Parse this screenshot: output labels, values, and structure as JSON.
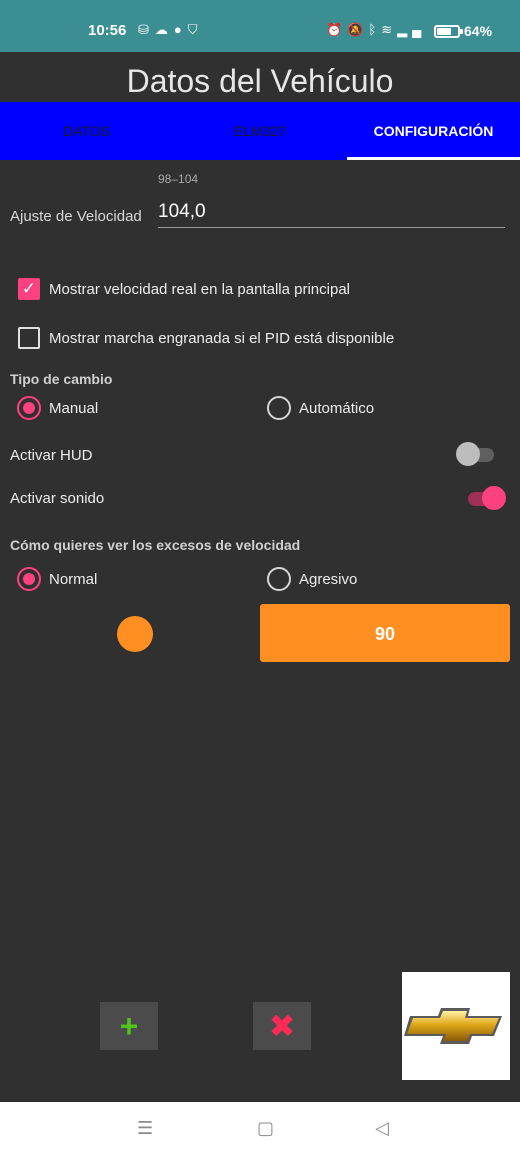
{
  "status_bar": {
    "time": "10:56",
    "left_icons": [
      "sim-icon",
      "cloud-icon",
      "app-icon",
      "shield-icon"
    ],
    "right_icons": [
      "alarm-icon",
      "mute-icon",
      "bluetooth-icon",
      "wifi-icon",
      "signal-icon"
    ],
    "battery_percent": "64%",
    "battery_level": 0.64,
    "background": "#3b8f92"
  },
  "app": {
    "title": "Datos del Vehículo"
  },
  "tabs": [
    {
      "label": "DATOS",
      "active": false
    },
    {
      "label": "ELM327",
      "active": false
    },
    {
      "label": "CONFIGURACIÓN",
      "active": true
    }
  ],
  "tabs_background": "#0000ff",
  "speed_setting": {
    "hint": "98–104",
    "label": "Ajuste de Velocidad",
    "value": "104,0"
  },
  "checkboxes": [
    {
      "label": "Mostrar velocidad real en la pantalla principal",
      "checked": true
    },
    {
      "label": "Mostrar marcha engranada si el PID está disponible",
      "checked": false
    }
  ],
  "gear_type": {
    "title": "Tipo de cambio",
    "options": [
      {
        "label": "Manual",
        "selected": true
      },
      {
        "label": "Automático",
        "selected": false
      }
    ]
  },
  "switches": [
    {
      "label": "Activar HUD",
      "on": false
    },
    {
      "label": "Activar sonido",
      "on": true
    }
  ],
  "excess_view": {
    "title": "Cómo quieres ver los excesos de velocidad",
    "options": [
      {
        "label": "Normal",
        "selected": true
      },
      {
        "label": "Agresivo",
        "selected": false
      }
    ]
  },
  "speed_limit_button": {
    "value": "90",
    "color": "#ff8f20"
  },
  "accent_color": "#ff4081",
  "bottom_actions": {
    "add_icon": "plus-icon",
    "remove_icon": "close-icon",
    "logo": "chevrolet-bowtie-logo"
  },
  "nav_bar": {
    "items": [
      "menu-icon",
      "home-icon",
      "back-icon"
    ]
  }
}
